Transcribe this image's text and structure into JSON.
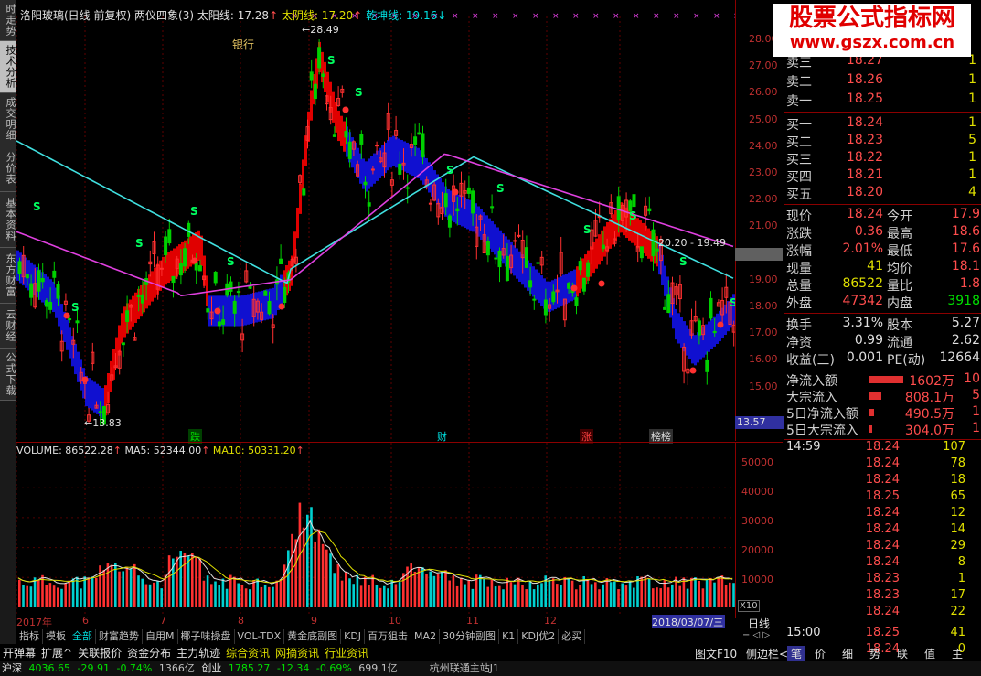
{
  "left_tabs": [
    "时走势",
    "技术分析",
    "成交明细",
    "分价表",
    "基本资料",
    "东方财富",
    "云财经",
    "公式下载"
  ],
  "title": {
    "stock": "洛阳玻璃(日线 前复权)",
    "indicator": "两仪四象(3)",
    "taiyang": "太阳线: 17.28",
    "taiyin": "太阴线: 17.20",
    "qiankun": "乾坤线: 19.16"
  },
  "annotations": {
    "bank": "银行",
    "high": "28.49",
    "low": "13.83",
    "range": "20.20 - 19.49",
    "die": "跌",
    "cai": "财",
    "zhang": "涨",
    "longhu": "榜榜",
    "last_price_tag": "13.57"
  },
  "price_axis": [
    "28.00",
    "27.00",
    "26.00",
    "25.00",
    "24.00",
    "23.00",
    "22.00",
    "21.00",
    "20.00",
    "19.00",
    "18.00",
    "17.00",
    "16.00",
    "15.00"
  ],
  "volume_axis": [
    "50000",
    "40000",
    "30000",
    "20000",
    "10000"
  ],
  "volume_title": {
    "vol": "VOLUME: 86522.28",
    "ma5": "MA5: 52344.00",
    "ma10": "MA10: 50331.20"
  },
  "x_labels": [
    "2017年",
    "6",
    "7",
    "8",
    "9",
    "10",
    "11",
    "12"
  ],
  "date_tag": "2018/03/07/三",
  "x10": "X10",
  "period": "日线",
  "indicator_tabs": [
    "指标",
    "模板",
    "全部",
    "财富趋势",
    "自用M",
    "椰子味操盘",
    "VOL-TDX",
    "黄金底副图",
    "KDJ",
    "百万狙击",
    "MA2",
    "30分钟副图",
    "K1",
    "KDJ优2",
    "必买"
  ],
  "active_indicator_tab": "全部",
  "func_bar": [
    "开弹幕",
    "扩展^",
    "关联报价",
    "资金分布",
    "主力轨迹",
    "综合资讯",
    "网摘资讯",
    "行业资讯"
  ],
  "func_bar_right": [
    "图文F10",
    "侧边栏<"
  ],
  "right_tabs": [
    "笔",
    "价",
    "细",
    "势",
    "联",
    "值",
    "主"
  ],
  "status": {
    "sh_label": "沪深",
    "sh_index": "4036.65",
    "sh_chg": "-29.91",
    "sh_pct": "-0.74%",
    "sh_amt": "1366亿",
    "cy_label": "创业",
    "cy_index": "1785.27",
    "cy_chg": "-12.34",
    "cy_pct": "-0.69%",
    "cy_amt": "699.1亿",
    "server": "杭州联通主站J1"
  },
  "watermark": {
    "line1": "股票公式指标网",
    "line2": "www.gszx.com.cn"
  },
  "order_book": {
    "sell": [
      {
        "label": "卖三",
        "price": "18.27",
        "vol": "1"
      },
      {
        "label": "卖二",
        "price": "18.26",
        "vol": "1"
      },
      {
        "label": "卖一",
        "price": "18.25",
        "vol": "1"
      }
    ],
    "buy": [
      {
        "label": "买一",
        "price": "18.24",
        "vol": "1"
      },
      {
        "label": "买二",
        "price": "18.23",
        "vol": "5"
      },
      {
        "label": "买三",
        "price": "18.22",
        "vol": "1"
      },
      {
        "label": "买四",
        "price": "18.21",
        "vol": "1"
      },
      {
        "label": "买五",
        "price": "18.20",
        "vol": "4"
      }
    ]
  },
  "quote": [
    {
      "l1": "现价",
      "v1": "18.24",
      "l2": "今开",
      "v2": "17.9"
    },
    {
      "l1": "涨跌",
      "v1": "0.36",
      "l2": "最高",
      "v2": "18.6"
    },
    {
      "l1": "涨幅",
      "v1": "2.01%",
      "l2": "最低",
      "v2": "17.6"
    },
    {
      "l1": "现量",
      "v1": "41",
      "l2": "均价",
      "v2": "18.1"
    },
    {
      "l1": "总量",
      "v1": "86522",
      "l2": "量比",
      "v2": "1.8"
    },
    {
      "l1": "外盘",
      "v1": "47342",
      "l2": "内盘",
      "v2": "3918"
    }
  ],
  "fundamentals": [
    {
      "l1": "换手",
      "v1": "3.31%",
      "l2": "股本",
      "v2": "5.27"
    },
    {
      "l1": "净资",
      "v1": "0.99",
      "l2": "流通",
      "v2": "2.62"
    },
    {
      "l1": "收益(三)",
      "v1": "0.001",
      "l2": "PE(动)",
      "v2": "12664"
    }
  ],
  "flows": [
    {
      "label": "净流入额",
      "value": "1602万",
      "extra": "10"
    },
    {
      "label": "大宗流入",
      "value": "808.1万",
      "extra": "5"
    },
    {
      "label": "5日净流入额",
      "value": "490.5万",
      "extra": "1"
    },
    {
      "label": "5日大宗流入",
      "value": "304.0万",
      "extra": "1"
    }
  ],
  "ticks": [
    {
      "time": "14:59",
      "price": "18.24",
      "vol": "107"
    },
    {
      "time": "",
      "price": "18.24",
      "vol": "78"
    },
    {
      "time": "",
      "price": "18.24",
      "vol": "18"
    },
    {
      "time": "",
      "price": "18.25",
      "vol": "65"
    },
    {
      "time": "",
      "price": "18.24",
      "vol": "12"
    },
    {
      "time": "",
      "price": "18.24",
      "vol": "14"
    },
    {
      "time": "",
      "price": "18.24",
      "vol": "29"
    },
    {
      "time": "",
      "price": "18.24",
      "vol": "8"
    },
    {
      "time": "",
      "price": "18.23",
      "vol": "1"
    },
    {
      "time": "",
      "price": "18.23",
      "vol": "17"
    },
    {
      "time": "",
      "price": "18.24",
      "vol": "22"
    },
    {
      "time": "15:00",
      "price": "18.25",
      "vol": "41"
    },
    {
      "time": "",
      "price": "18.24",
      "vol": "0"
    }
  ]
}
